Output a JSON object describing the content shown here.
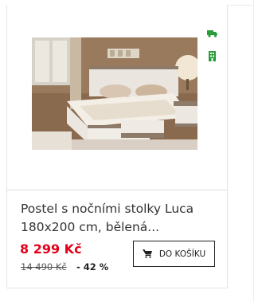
{
  "product": {
    "title": "Postel s nočními stolky Luca 180x200 cm, bělená...",
    "price": "8 299 Kč",
    "old_price": "14 490 Kč",
    "discount": "- 42 %",
    "cart_button_label": "DO KOŠÍKU",
    "image_alt": "Postel s nočními stolky Luca"
  },
  "icons": {
    "delivery": "truck-icon",
    "availability": "building-icon",
    "cart": "cart-icon"
  },
  "colors": {
    "accent_green": "#2a9d3a",
    "price_red": "#e3001b"
  }
}
